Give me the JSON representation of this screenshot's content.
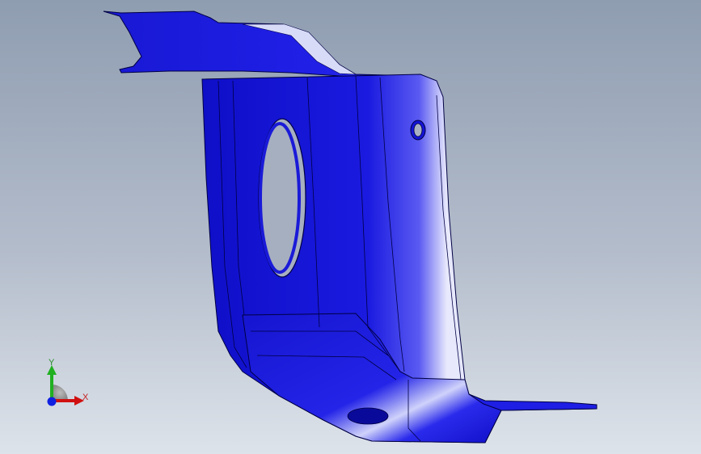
{
  "viewport": {
    "background_top": "#8f9db1",
    "background_bottom": "#dde3ea"
  },
  "model": {
    "part_color": "#1414d8",
    "highlight_color": "#e6e8fb",
    "edge_color": "#000044"
  },
  "triad": {
    "x_label": "X",
    "y_label": "Y",
    "x_color": "#d01010",
    "y_color": "#20b020",
    "z_color": "#1020e0"
  }
}
